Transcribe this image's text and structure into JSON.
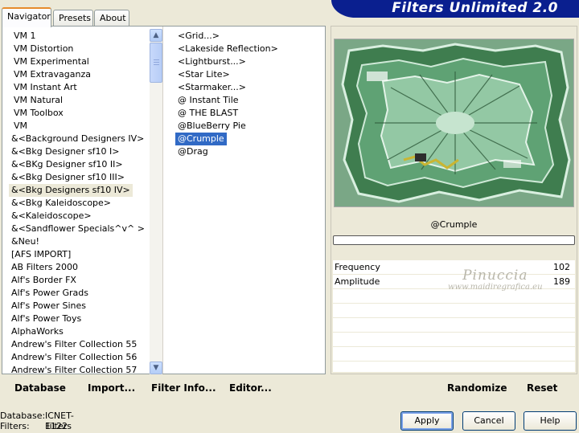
{
  "header": {
    "title": "Filters Unlimited 2.0"
  },
  "tabs": [
    {
      "label": "Navigator",
      "active": true
    },
    {
      "label": "Presets",
      "active": false
    },
    {
      "label": "About",
      "active": false
    }
  ],
  "categories": [
    "VM 1",
    "VM Distortion",
    "VM Experimental",
    "VM Extravaganza",
    "VM Instant Art",
    "VM Natural",
    "VM Toolbox",
    "VM",
    "&<Background Designers IV>",
    "&<Bkg Designer sf10 I>",
    "&<BKg Designer sf10 II>",
    "&<Bkg Designer sf10 III>",
    "&<Bkg Designers sf10 IV>",
    "&<Bkg Kaleidoscope>",
    "&<Kaleidoscope>",
    "&<Sandflower Specials^v^ >",
    "&Neu!",
    "[AFS IMPORT]",
    "AB Filters 2000",
    "Alf's Border FX",
    "Alf's Power Grads",
    "Alf's Power Sines",
    "Alf's Power Toys",
    "AlphaWorks",
    "Andrew's Filter Collection 55",
    "Andrew's Filter Collection 56",
    "Andrew's Filter Collection 57"
  ],
  "categories_selected_index": 12,
  "filters": [
    "<Grid...>",
    "<Lakeside Reflection>",
    "<Lightburst...>",
    "<Star Lite>",
    "<Starmaker...>",
    "@ Instant Tile",
    "@ THE BLAST",
    "@BlueBerry Pie",
    "@Crumple",
    "@Drag"
  ],
  "filters_selected_index": 8,
  "preview": {
    "filter_name": "@Crumple",
    "params": [
      {
        "label": "Frequency",
        "value": "102"
      },
      {
        "label": "Amplitude",
        "value": "189"
      }
    ],
    "watermark_name": "Pinuccia",
    "watermark_url": "www.maidiregrafica.eu",
    "colors": {
      "bg": "#6d9e79",
      "frame": "#3f7d4f",
      "center": "#c6e4cf",
      "accent": "#c9b532"
    }
  },
  "links": {
    "database": "Database",
    "import": "Import...",
    "filter_info": "Filter Info...",
    "editor": "Editor...",
    "randomize": "Randomize",
    "reset": "Reset"
  },
  "footer": {
    "database_label": "Database:",
    "database_value": "ICNET-Filters",
    "filters_label": "Filters:",
    "filters_value": "1122"
  },
  "buttons": {
    "apply": "Apply",
    "cancel": "Cancel",
    "help": "Help"
  }
}
